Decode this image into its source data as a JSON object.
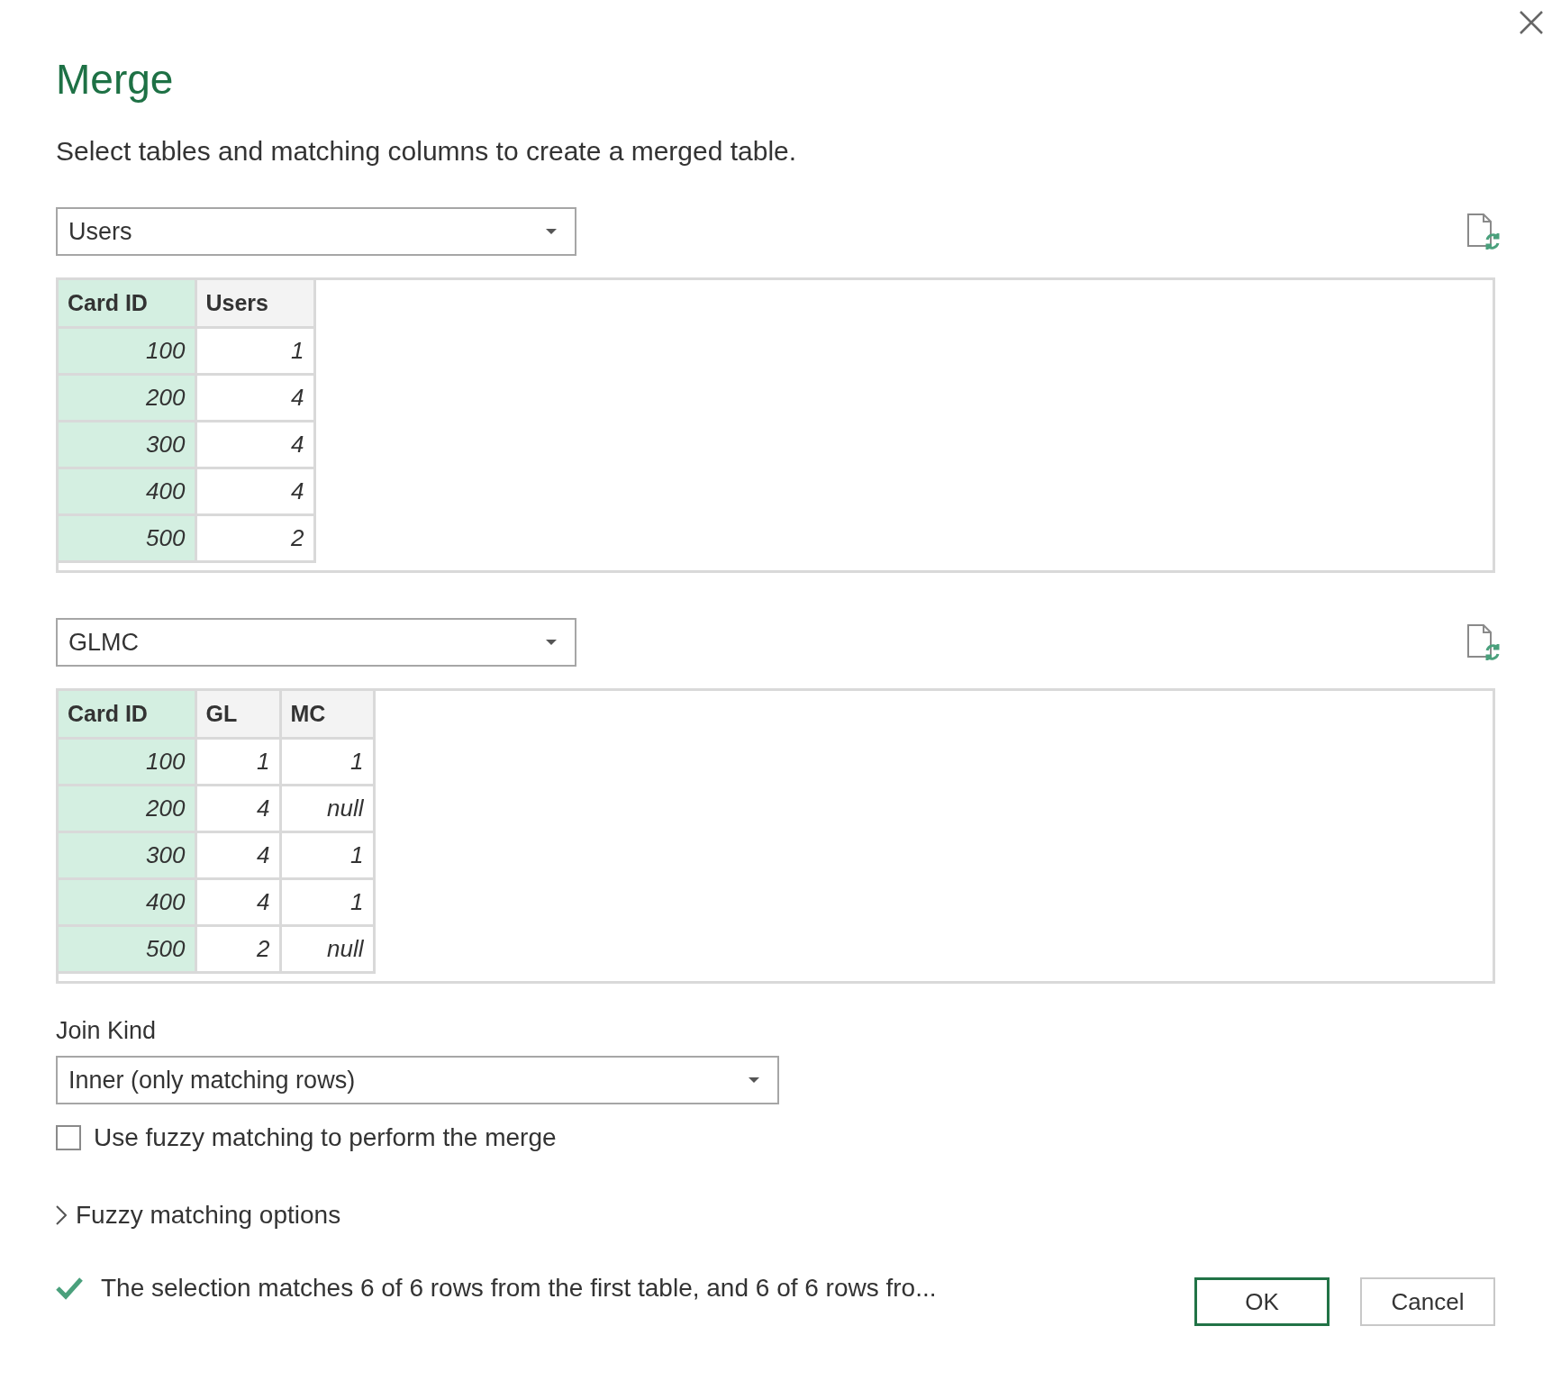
{
  "dialog": {
    "title": "Merge",
    "subtitle": "Select tables and matching columns to create a merged table."
  },
  "tables": [
    {
      "dropdown": "Users",
      "columns": [
        {
          "label": "Card ID",
          "selected": true
        },
        {
          "label": "Users",
          "selected": false
        }
      ],
      "rows": [
        [
          "100",
          "1"
        ],
        [
          "200",
          "4"
        ],
        [
          "300",
          "4"
        ],
        [
          "400",
          "4"
        ],
        [
          "500",
          "2"
        ]
      ]
    },
    {
      "dropdown": "GLMC",
      "columns": [
        {
          "label": "Card ID",
          "selected": true
        },
        {
          "label": "GL",
          "selected": false
        },
        {
          "label": "MC",
          "selected": false
        }
      ],
      "rows": [
        [
          "100",
          "1",
          "1"
        ],
        [
          "200",
          "4",
          "null"
        ],
        [
          "300",
          "4",
          "1"
        ],
        [
          "400",
          "4",
          "1"
        ],
        [
          "500",
          "2",
          "null"
        ]
      ]
    }
  ],
  "join_kind": {
    "label": "Join Kind",
    "value": "Inner (only matching rows)"
  },
  "fuzzy_matching": {
    "label": "Use fuzzy matching to perform the merge",
    "checked": false
  },
  "fuzzy_options": {
    "label": "Fuzzy matching options",
    "expanded": false
  },
  "status": {
    "text": "The selection matches 6 of 6 rows from the first table, and 6 of 6 rows fro..."
  },
  "buttons": [
    {
      "label": "OK",
      "default": true
    },
    {
      "label": "Cancel",
      "default": false
    }
  ]
}
